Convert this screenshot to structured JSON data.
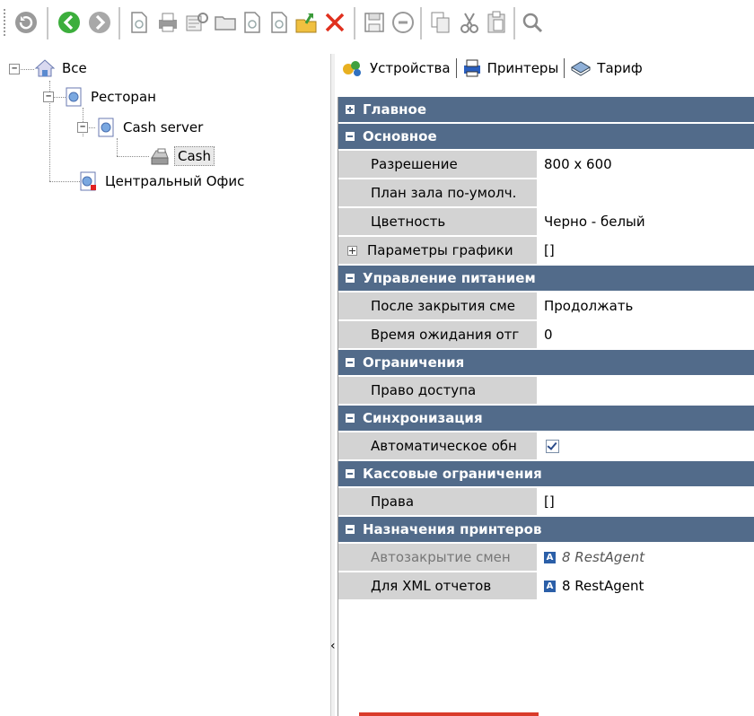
{
  "toolbar": {
    "buttons": [
      "refresh-icon",
      "back-icon",
      "forward-icon",
      "new-document-icon",
      "print-icon",
      "print-preview-icon",
      "folder-icon",
      "copy-document-icon",
      "new-document-icon",
      "import-icon",
      "delete-icon",
      "save-icon",
      "undo-icon",
      "copy-icon",
      "cut-icon",
      "paste-icon",
      "search-icon"
    ]
  },
  "tree": {
    "root": {
      "label": "Все",
      "icon": "house-icon"
    },
    "restaurant": {
      "label": "Ресторан"
    },
    "cash_server": {
      "label": "Cash server"
    },
    "cash": {
      "label": "Cash"
    },
    "central_office": {
      "label": "Центральный Офис"
    }
  },
  "tabs": [
    {
      "label": "Устройства",
      "icon": "devices-icon"
    },
    {
      "label": "Принтеры",
      "icon": "printer-icon"
    },
    {
      "label": "Тариф",
      "icon": "tariff-icon"
    }
  ],
  "grid": {
    "cat_main": "Главное",
    "cat_basic": "Основное",
    "resolution": {
      "name": "Разрешение",
      "value": "800 x 600"
    },
    "hall_plan": {
      "name": "План зала по-умолч.",
      "value": ""
    },
    "color": {
      "name": "Цветность",
      "value": "Черно - белый"
    },
    "graphics": {
      "name": "Параметры графики",
      "value": "[]"
    },
    "cat_power": "Управление питанием",
    "after_close": {
      "name": "После закрытия сме",
      "value": "Продолжать"
    },
    "wait_time": {
      "name": "Время ожидания отг",
      "value": "0"
    },
    "cat_limits": "Ограничения",
    "access": {
      "name": "Право доступа",
      "value": ""
    },
    "cat_sync": "Синхронизация",
    "auto_update": {
      "name": "Автоматическое обн",
      "checked": true
    },
    "cat_cash_limits": "Кассовые ограничения",
    "rights": {
      "name": "Права",
      "value": "[]"
    },
    "cat_printers": "Назначения принтеров",
    "auto_close": {
      "name": "Автозакрытие смен",
      "value": "8 RestAgent"
    },
    "xml_reports": {
      "name": "Для XML отчетов",
      "value": "8 RestAgent"
    }
  },
  "colors": {
    "category_bg": "#526b8a",
    "name_bg": "#d3d3d3",
    "accent_red": "#d93b2a"
  }
}
